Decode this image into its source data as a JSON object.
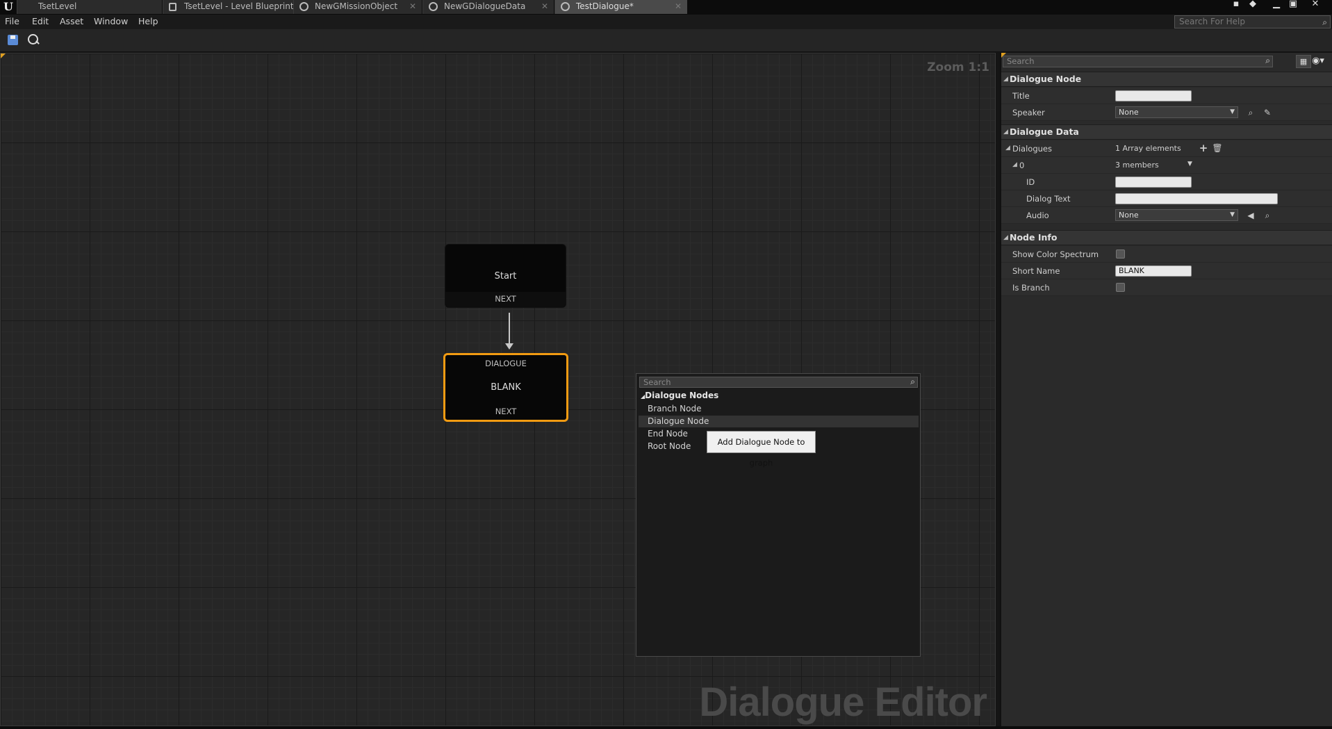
{
  "tabs": [
    {
      "label": "TsetLevel",
      "icon": "level-icon"
    },
    {
      "label": "TsetLevel - Level Blueprint",
      "icon": "blueprint-icon"
    },
    {
      "label": "NewGMissionObject",
      "icon": "asset-circle-icon"
    },
    {
      "label": "NewGDialogueData",
      "icon": "asset-circle-icon"
    },
    {
      "label": "TestDialogue*",
      "icon": "asset-circle-icon",
      "active": true
    }
  ],
  "menu": {
    "file": "File",
    "edit": "Edit",
    "asset": "Asset",
    "window": "Window",
    "help": "Help"
  },
  "help_search": {
    "placeholder": "Search For Help"
  },
  "graph": {
    "zoom": "Zoom 1:1",
    "watermark": "Dialogue Editor"
  },
  "nodes": {
    "start": {
      "title": "Start",
      "pin": "NEXT"
    },
    "dialogue": {
      "type": "DIALOGUE",
      "title": "BLANK",
      "pin": "NEXT",
      "accent": "#f29b12"
    }
  },
  "context_menu": {
    "search_placeholder": "Search",
    "category": "Dialogue Nodes",
    "items": [
      "Branch Node",
      "Dialogue Node",
      "End Node",
      "Root Node"
    ],
    "hovered": "Dialogue Node",
    "tooltip": "Add Dialogue Node to graph"
  },
  "details": {
    "search_placeholder": "Search",
    "sections": {
      "dialogue_node": {
        "header": "Dialogue Node",
        "title_label": "Title",
        "title_value": "",
        "speaker_label": "Speaker",
        "speaker_value": "None"
      },
      "dialogue_data": {
        "header": "Dialogue Data",
        "dialogues_label": "Dialogues",
        "dialogues_value": "1 Array elements",
        "element_index": "0",
        "element_members": "3 members",
        "id_label": "ID",
        "id_value": "",
        "dialog_text_label": "Dialog Text",
        "dialog_text_value": "",
        "audio_label": "Audio",
        "audio_value": "None"
      },
      "node_info": {
        "header": "Node Info",
        "show_color_spectrum_label": "Show Color Spectrum",
        "short_name_label": "Short Name",
        "short_name_value": "BLANK",
        "is_branch_label": "Is Branch"
      }
    }
  }
}
